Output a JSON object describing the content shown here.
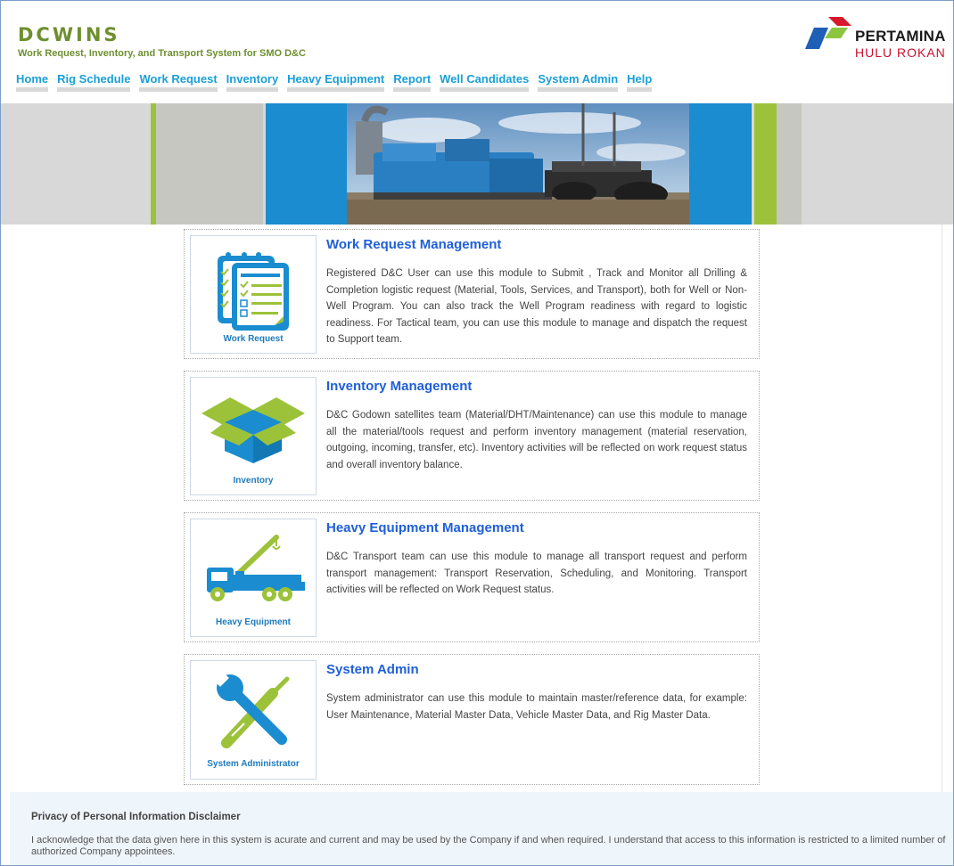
{
  "header": {
    "app_name": "DCWINS",
    "app_subtitle": "Work Request, Inventory, and Transport System for SMO D&C",
    "logo_name": "PERTAMINA",
    "logo_sub": "HULU ROKAN"
  },
  "nav": {
    "items": [
      "Home",
      "Rig Schedule",
      "Work Request",
      "Inventory",
      "Heavy Equipment",
      "Report",
      "Well Candidates",
      "System Admin",
      "Help"
    ]
  },
  "modules": [
    {
      "icon": "clipboard-checklist-icon",
      "icon_label": "Work Request",
      "title": "Work Request Management",
      "description": "Registered D&C User can use this module to Submit , Track and Monitor all Drilling & Completion logistic request (Material, Tools, Services, and Transport), both for Well or Non-Well Program. You can also track the Well Program readiness with regard to logistic readiness. For Tactical team, you can use this module to manage and dispatch the request to Support team."
    },
    {
      "icon": "open-box-icon",
      "icon_label": "Inventory",
      "title": "Inventory Management",
      "description": "D&C Godown satellites team (Material/DHT/Maintenance) can use this module to manage all the material/tools request and perform inventory management (material reservation, outgoing, incoming, transfer, etc). Inventory activities will be reflected on work request status and overall inventory balance."
    },
    {
      "icon": "crane-truck-icon",
      "icon_label": "Heavy Equipment",
      "title": "Heavy Equipment Management",
      "description": "D&C Transport team can use this module to manage all transport request and perform transport management: Transport Reservation, Scheduling, and Monitoring. Transport activities will be reflected on Work Request status."
    },
    {
      "icon": "wrench-screwdriver-icon",
      "icon_label": "System Administrator",
      "title": "System Admin",
      "description": "System administrator can use this module to maintain master/reference data, for example: User Maintenance, Material Master Data, Vehicle Master Data, and Rig Master Data."
    }
  ],
  "footer": {
    "title": "Privacy of Personal Information Disclaimer",
    "text": "I acknowledge that the data given here in this system is acurate and current and may be used by the Company if and when required. I understand that access to this information is restricted to a limited number of authorized Company appointees."
  },
  "colors": {
    "brand_green": "#6e8f2f",
    "nav_blue": "#1a9fd8",
    "title_blue": "#1f5fd8",
    "icon_blue": "#1a8ccf",
    "icon_green": "#9cc23a",
    "logo_red": "#c8102e"
  }
}
